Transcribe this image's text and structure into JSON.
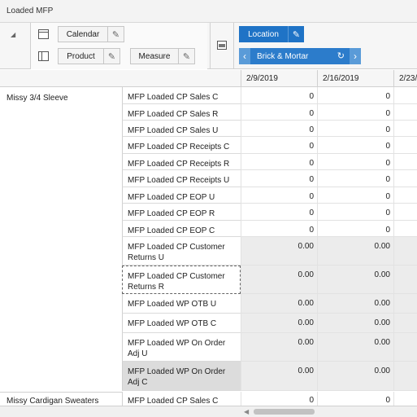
{
  "window": {
    "title": "Loaded MFP"
  },
  "pivot": {
    "calendar_label": "Calendar",
    "product_label": "Product",
    "measure_label": "Measure",
    "location_label": "Location",
    "location_member": "Brick & Mortar",
    "icons": [
      "collapse-triangle-icon",
      "row-layout-icon",
      "column-layout-icon",
      "pencil-icon",
      "swap-axis-icon",
      "chevron-left-icon",
      "chevron-right-icon",
      "reset-icon"
    ]
  },
  "columns": [
    "2/9/2019",
    "2/16/2019",
    "2/23/"
  ],
  "groups": [
    {
      "name": "Missy 3/4 Sleeve",
      "rows": [
        {
          "measure": "MFP Loaded CP Sales C",
          "v1": "0",
          "v2": "0"
        },
        {
          "measure": "MFP Loaded CP Sales R",
          "v1": "0",
          "v2": "0"
        },
        {
          "measure": "MFP Loaded CP Sales U",
          "v1": "0",
          "v2": "0"
        },
        {
          "measure": "MFP Loaded CP Receipts C",
          "v1": "0",
          "v2": "0"
        },
        {
          "measure": "MFP Loaded CP Receipts R",
          "v1": "0",
          "v2": "0"
        },
        {
          "measure": "MFP Loaded CP Receipts U",
          "v1": "0",
          "v2": "0"
        },
        {
          "measure": "MFP Loaded CP EOP U",
          "v1": "0",
          "v2": "0"
        },
        {
          "measure": "MFP Loaded CP EOP R",
          "v1": "0",
          "v2": "0"
        },
        {
          "measure": "MFP Loaded CP EOP C",
          "v1": "0",
          "v2": "0"
        },
        {
          "measure": "MFP Loaded CP Customer Returns U",
          "v1": "0.00",
          "v2": "0.00"
        },
        {
          "measure": "MFP Loaded CP Customer Returns R",
          "v1": "0.00",
          "v2": "0.00"
        },
        {
          "measure": "MFP Loaded WP OTB U",
          "v1": "0.00",
          "v2": "0.00"
        },
        {
          "measure": "MFP Loaded WP OTB C",
          "v1": "0.00",
          "v2": "0.00"
        },
        {
          "measure": "MFP Loaded WP On Order Adj U",
          "v1": "0.00",
          "v2": "0.00"
        },
        {
          "measure": "MFP Loaded WP On Order Adj C",
          "v1": "0.00",
          "v2": "0.00"
        }
      ]
    },
    {
      "name": "Missy Cardigan Sweaters",
      "rows": [
        {
          "measure": "MFP Loaded CP Sales C",
          "v1": "0",
          "v2": "0"
        }
      ]
    }
  ],
  "colors": {
    "accent": "#1f73c6",
    "nav": "#6aa9e4",
    "shade": "#ececec",
    "selected": "#dcdcdc"
  }
}
